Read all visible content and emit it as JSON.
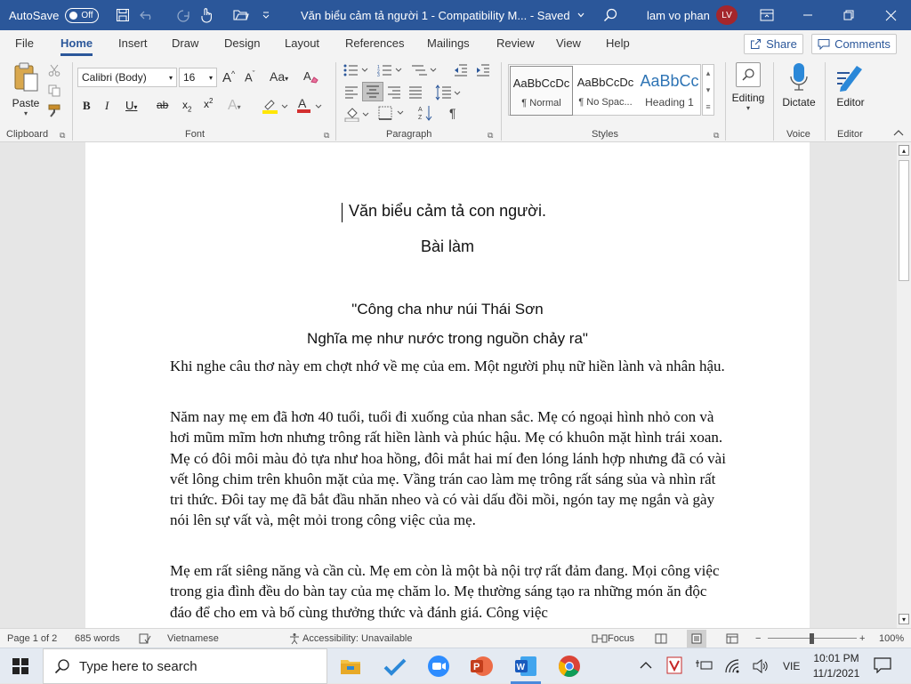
{
  "titlebar": {
    "autosave_label": "AutoSave",
    "autosave_state": "Off",
    "document_title": "Văn biểu cảm tả người 1  -  Compatibility M...  -  Saved",
    "user_name": "lam vo phan",
    "user_initials": "LV"
  },
  "tabs": [
    "File",
    "Home",
    "Insert",
    "Draw",
    "Design",
    "Layout",
    "References",
    "Mailings",
    "Review",
    "View",
    "Help"
  ],
  "share_label": "Share",
  "comments_label": "Comments",
  "ribbon": {
    "paste_label": "Paste",
    "font_name": "Calibri (Body)",
    "font_size": "16",
    "styles": [
      {
        "preview": "AaBbCcDc",
        "name": "¶ Normal"
      },
      {
        "preview": "AaBbCcDc",
        "name": "¶ No Spac..."
      },
      {
        "preview": "AaBbCc",
        "name": "Heading 1"
      }
    ],
    "editing_label": "Editing",
    "dictate_label": "Dictate",
    "editor_label": "Editor",
    "groups": {
      "clipboard": "Clipboard",
      "font": "Font",
      "paragraph": "Paragraph",
      "styles": "Styles",
      "voice": "Voice",
      "editor": "Editor"
    }
  },
  "document": {
    "title": "Văn biểu cảm tả con người.",
    "subtitle": "Bài làm",
    "quote_line1": "\"Công cha như núi Thái Sơn",
    "quote_line2": "Nghĩa mẹ như nước trong nguồn chảy ra\"",
    "para1": "Khi nghe câu thơ này em chợt nhớ về mẹ của em. Một người phụ nữ hiền lành và nhân hậu.",
    "para2": "Năm nay mẹ em đã hơn 40 tuổi, tuổi đi xuống của  nhan sắc. Mẹ có ngoại hình nhỏ con và hơi mũm mĩm hơn nhưng trông rất hiền lành và phúc hậu. Mẹ có khuôn mặt hình trái xoan. Mẹ có đôi môi màu đỏ tựa như hoa hồng, đôi mắt hai mí đen lóng lánh hợp nhưng đã có vài vết lông chim trên khuôn mặt của mẹ. Vầng trán cao làm mẹ trông rất sáng sủa và nhìn rất tri thức. Đôi tay mẹ đã bắt đầu nhăn nheo và có vài dấu đồi mồi, ngón tay mẹ ngắn và gày nói lên sự vất và, mệt mỏi trong công việc của mẹ.",
    "para3": "Mẹ em rất siêng năng và cần cù. Mẹ em còn là một bà nội trợ rất đảm đang. Mọi công việc trong gia đình đều do bàn tay của mẹ chăm lo. Mẹ thường sáng tạo ra những món ăn độc đáo để cho em và bố cùng thưởng thức và đánh giá. Công việc"
  },
  "status": {
    "page": "Page 1 of 2",
    "words": "685 words",
    "language": "Vietnamese",
    "accessibility": "Accessibility: Unavailable",
    "focus": "Focus",
    "zoom": "100%"
  },
  "taskbar": {
    "search_placeholder": "Type here to search",
    "language": "VIE",
    "time": "10:01 PM",
    "date": "11/1/2021"
  },
  "colors": {
    "title_bar": "#2b579a",
    "accent": "#2b579a",
    "avatar": "#a4262c"
  }
}
